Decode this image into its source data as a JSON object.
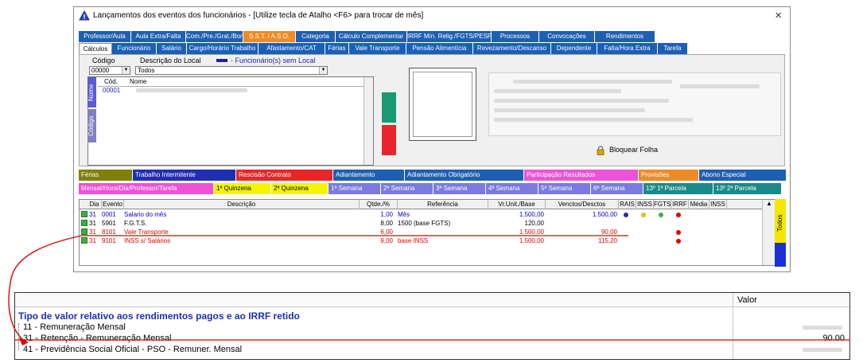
{
  "window": {
    "title": "Lançamentos dos eventos dos funcionários - [Utilize tecla de Atalho <F6> para trocar de mês]",
    "close": "×"
  },
  "tabs_row1": [
    {
      "label": "Professor/Aula",
      "style": "blue"
    },
    {
      "label": "Aula Extra/Falta",
      "style": "blue"
    },
    {
      "label": "Com./Pre./Grat./Bon",
      "style": "blue"
    },
    {
      "label": "S.S.T. / A.S.O.",
      "style": "orange"
    },
    {
      "label": "Categoria",
      "style": "blue"
    },
    {
      "label": "Cálculo Complementar",
      "style": "blue"
    },
    {
      "label": "IRRF Mín. Relig./FGTS/PESP",
      "style": "blue"
    },
    {
      "label": "Processos",
      "style": "blue"
    },
    {
      "label": "Convocações",
      "style": "blue"
    },
    {
      "label": "Rendimentos",
      "style": "blue"
    }
  ],
  "tabs_row2": [
    {
      "label": "Cálculos",
      "style": "active"
    },
    {
      "label": "Funcionário",
      "style": "blue"
    },
    {
      "label": "Salário",
      "style": "blue"
    },
    {
      "label": "Cargo/Horário Trabalho",
      "style": "blue"
    },
    {
      "label": "Afastamento/CAT",
      "style": "blue"
    },
    {
      "label": "Férias",
      "style": "blue"
    },
    {
      "label": "Vale Transporte",
      "style": "blue"
    },
    {
      "label": "Pensão Alimentícia",
      "style": "blue"
    },
    {
      "label": "Revezamento/Descanso",
      "style": "blue"
    },
    {
      "label": "Dependente",
      "style": "blue"
    },
    {
      "label": "Falta/Hora Extra",
      "style": "blue"
    },
    {
      "label": "Tarefa",
      "style": "blue"
    }
  ],
  "filters": {
    "codigo_label": "Código",
    "codigo_value": "00000",
    "descricao_label": "Descrição do Local",
    "descricao_value": "Todos",
    "legend_text": "- Funcionário(s) sem Local"
  },
  "employee_grid": {
    "col_cod": "Cód.",
    "col_nome": "Nome",
    "first_code": "00001",
    "vtab_nome": "Nome",
    "vtab_codigo": "Código"
  },
  "lock_button": "Bloquear Folha",
  "categories_row1": [
    {
      "label": "Férias",
      "bg": "#808000",
      "fg": "#ffffff"
    },
    {
      "label": "Trabalho Intermitente",
      "bg": "#1e2fb5",
      "fg": "#ffffff"
    },
    {
      "label": "Rescisão Contrato",
      "bg": "#e8262a",
      "fg": "#ffffff"
    },
    {
      "label": "Adiantamento",
      "bg": "#1d5fb3",
      "fg": "#ffffff"
    },
    {
      "label": "Adiantamento Obrigatório",
      "bg": "#1d5fb3",
      "fg": "#ffffff"
    },
    {
      "label": "Participação Resultados",
      "bg": "#ee52d6",
      "fg": "#ffffff"
    },
    {
      "label": "Provisões",
      "bg": "#f08a24",
      "fg": "#ffffff"
    },
    {
      "label": "Abono Especial",
      "bg": "#1d5fb3",
      "fg": "#ffffff"
    }
  ],
  "categories_row2": [
    {
      "label": "Mensal/Hora/Dia/Professor/Tarefa",
      "bg": "#ee52d6",
      "fg": "#ffffff"
    },
    {
      "label": "1ª Quinzena",
      "bg": "#f5f500",
      "fg": "#000000"
    },
    {
      "label": "2ª Quinzena",
      "bg": "#f5f500",
      "fg": "#000000"
    },
    {
      "label": "1ª Semana",
      "bg": "#7a7ae0",
      "fg": "#ffffff"
    },
    {
      "label": "2ª Semana",
      "bg": "#7a7ae0",
      "fg": "#ffffff"
    },
    {
      "label": "3ª Semana",
      "bg": "#7a7ae0",
      "fg": "#ffffff"
    },
    {
      "label": "4ª Semana",
      "bg": "#7a7ae0",
      "fg": "#ffffff"
    },
    {
      "label": "5ª Semana",
      "bg": "#7a7ae0",
      "fg": "#ffffff"
    },
    {
      "label": "6ª Semana",
      "bg": "#7a7ae0",
      "fg": "#ffffff"
    },
    {
      "label": "13º 1ª Parcela",
      "bg": "#1a8a8a",
      "fg": "#ffffff"
    },
    {
      "label": "13º 2ª Parcela",
      "bg": "#1a8a8a",
      "fg": "#ffffff"
    }
  ],
  "events_table": {
    "headers": [
      "Dia",
      "Evento",
      "Descrição",
      "Qtde./%",
      "Referência",
      "Vr.Unit./Base",
      "Venctos/Desctos",
      "RAIS",
      "INSS",
      "FGTS",
      "IRRF",
      "Média",
      "INSS"
    ],
    "rows": [
      {
        "dia": "31",
        "evento": "0001",
        "descricao": "Salario do mês",
        "qtde": "1,00",
        "referencia": "Mês",
        "base": "1.500,00",
        "valor": "1.500,00",
        "color": "#0000cc"
      },
      {
        "dia": "31",
        "evento": "5901",
        "descricao": "F.G.T.S.",
        "qtde": "8,00",
        "referencia": "1500 (base FGTS)",
        "base": "120,00",
        "valor": "",
        "color": "#000000"
      },
      {
        "dia": "31",
        "evento": "8101",
        "descricao": "Vale Transporte",
        "qtde": "6,00",
        "referencia": "",
        "base": "1.500,00",
        "valor": "90,00",
        "color": "#e00000"
      },
      {
        "dia": "31",
        "evento": "9101",
        "descricao": "INSS s/ Salários",
        "qtde": "9,00",
        "referencia": "base INSS",
        "base": "1.500,00",
        "valor": "115,20",
        "color": "#e00000"
      }
    ],
    "side_label": "Todos"
  },
  "irrf_panel": {
    "valor_header": "Valor",
    "title": "Tipo de valor relativo aos rendimentos pagos e ao IRRF retido",
    "items": [
      {
        "label": "11 - Remuneração Mensal",
        "value": ""
      },
      {
        "label": "31 - Retenção - Remuneração Mensal",
        "value": "90.00"
      },
      {
        "label": "41 - Previdência Social Oficial - PSO - Remuner. Mensal",
        "value": ""
      }
    ]
  },
  "colors": {
    "accent_blue": "#1d5fb3",
    "annotation_red": "#e00000",
    "title_blue": "#1e2fb5"
  }
}
